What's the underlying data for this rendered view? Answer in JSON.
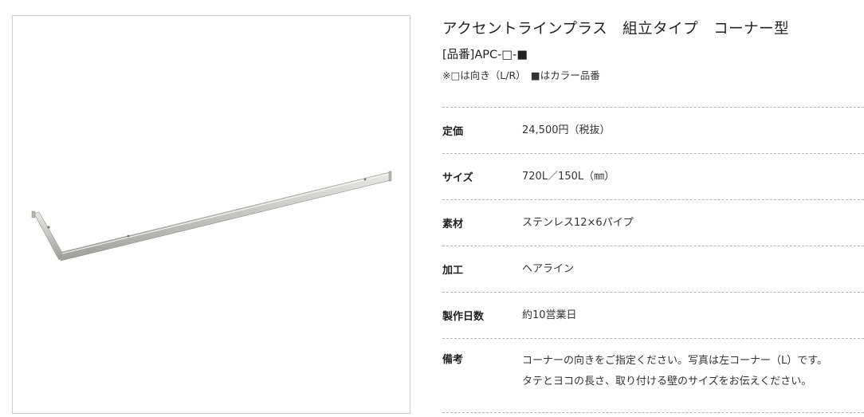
{
  "product": {
    "image_alt": "アクセントラインプラス 組立タイプ コーナー型",
    "title": "アクセントラインプラス　組立タイプ　コーナー型",
    "code": "[品番]APC-□-■",
    "note": "※□は向き（L/R）　■はカラー品番"
  },
  "specs": [
    {
      "label": "定価",
      "value": "24,500円（税抜）"
    },
    {
      "label": "サイズ",
      "value": "720L／150L（㎜）"
    },
    {
      "label": "素材",
      "value": "ステンレス12×6パイプ"
    },
    {
      "label": "加工",
      "value": "ヘアライン"
    },
    {
      "label": "製作日数",
      "value": "約10営業日"
    },
    {
      "label": "備考",
      "value_lines": [
        "コーナーの向きをご指定ください。写真は左コーナー（L）です。",
        "タテとヨコの長さ、取り付ける壁のサイズをお伝えください。"
      ]
    }
  ],
  "colors": {
    "divider": "#b5b5b5",
    "frame": "#cfcfcf",
    "metal": "#c8c8c4"
  }
}
